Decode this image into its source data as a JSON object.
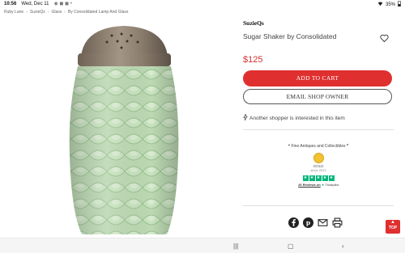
{
  "status_bar": {
    "time": "10:56",
    "date": "Wed, Dec 11",
    "battery": "35%"
  },
  "breadcrumb": [
    "Ruby Lane",
    "SuzieQs",
    "Glass",
    "By Consolidated Lamp And Glass"
  ],
  "product": {
    "shop_name": "SuzieQs",
    "title": "Sugar Shaker by Consolidated",
    "price": "$125",
    "image_icon": "milk-glass-sugar-shaker-photo",
    "glass_color": "#b9d7b0",
    "lid_color": "#8a7a68"
  },
  "actions": {
    "add_to_cart": "ADD TO CART",
    "email_owner": "EMAIL SHOP OWNER"
  },
  "interest_text": "Another shopper is interested in this item",
  "dealer": {
    "tagline": "❝ Fine Antiques and Collectibles ❞",
    "badge_level": "GOLD",
    "since": "since 2013",
    "reviews_count": "26 Reviews on",
    "trustpilot": "Trustpilot",
    "rating_stars": 5
  },
  "share_icons": [
    "facebook-icon",
    "pinterest-icon",
    "email-icon",
    "print-icon"
  ],
  "top_button": "TOP",
  "colors": {
    "accent": "#e02f2f",
    "trustpilot_green": "#00b67a",
    "gold": "#f2c230"
  }
}
